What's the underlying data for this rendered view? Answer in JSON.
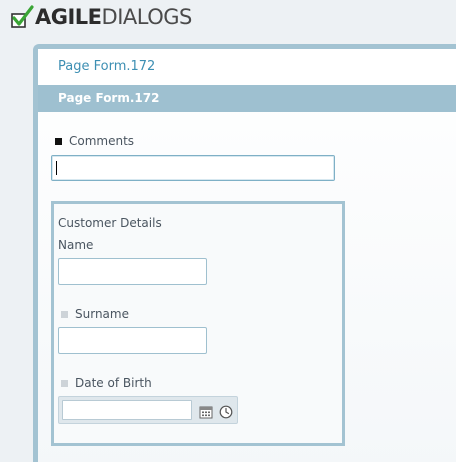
{
  "logo": {
    "brand_bold": "AGILE",
    "brand_light": "DIALOGS"
  },
  "page": {
    "title": "Page Form.172",
    "header": "Page Form.172"
  },
  "form": {
    "comments": {
      "label": "Comments",
      "value": ""
    },
    "customer_group": {
      "title": "Customer Details",
      "name": {
        "label": "Name",
        "value": ""
      },
      "surname": {
        "label": "Surname",
        "value": ""
      },
      "dob": {
        "label": "Date of Birth",
        "value": ""
      }
    }
  },
  "colors": {
    "accent": "#3d8fb3",
    "header_bg": "#9ec0d0",
    "border": "#a3c3d2",
    "logo_check": "#3aa535"
  },
  "icons": [
    "checkmark-logo-icon",
    "calendar-icon",
    "clock-icon"
  ]
}
